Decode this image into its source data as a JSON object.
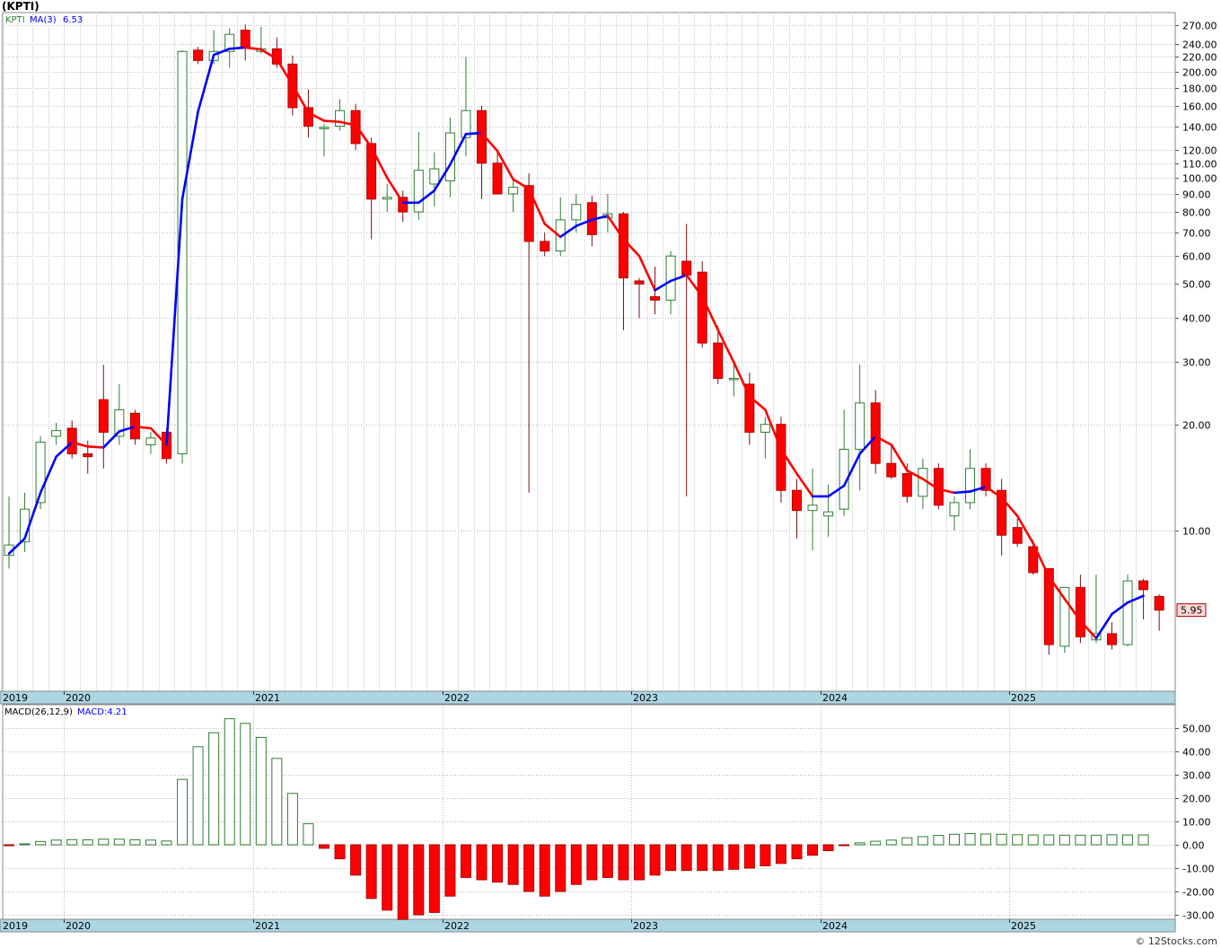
{
  "title": "(KPTI)",
  "legend": {
    "ticker": "KPTI",
    "ma_label": "MA(3)",
    "ma_value": "6.53"
  },
  "last_price_label": "5.95",
  "macd_legend": {
    "label": "MACD(26,12,9)",
    "value": "MACD:4.21"
  },
  "credit": "© 12Stocks.com",
  "colors": {
    "up_candle": "#2e7d32",
    "down_candle": "#ff0000",
    "ma_up": "#0000ff",
    "ma_down": "#ff0000",
    "macd_positive": "#2e7d32",
    "macd_negative": "#ff0000",
    "axis_band": "#acd6e2"
  },
  "chart_data": [
    {
      "type": "candlestick",
      "title": "(KPTI)",
      "scale": "log",
      "frequency": "monthly",
      "ylim": [
        4.6,
        290
      ],
      "y_ticks": [
        "270.00",
        "240.00",
        "220.00",
        "200.00",
        "180.00",
        "160.00",
        "140.00",
        "120.00",
        "110.00",
        "100.00",
        "90.00",
        "80.00",
        "70.00",
        "60.00",
        "50.00",
        "40.00",
        "30.00",
        "20.00",
        "10.00"
      ],
      "x_ticks": [
        "2019",
        "2020",
        "2021",
        "2022",
        "2023",
        "2024",
        "2025"
      ],
      "grid": true,
      "series": [
        {
          "name": "KPTI",
          "ohlc": [
            [
              8.5,
              12.5,
              7.8,
              9.1
            ],
            [
              9.3,
              12.8,
              8.7,
              11.5
            ],
            [
              12.0,
              18.5,
              11.5,
              17.8
            ],
            [
              18.5,
              20.2,
              17.5,
              19.2
            ],
            [
              19.5,
              20.5,
              16.0,
              16.5
            ],
            [
              16.5,
              18.0,
              14.5,
              16.2
            ],
            [
              23.5,
              29.5,
              15.0,
              19.0
            ],
            [
              18.5,
              26.0,
              17.5,
              22.0
            ],
            [
              21.5,
              22.0,
              17.5,
              18.2
            ],
            [
              17.5,
              19.0,
              16.5,
              18.3
            ],
            [
              19.0,
              19.5,
              15.5,
              16.0
            ],
            [
              16.5,
              230,
              15.5,
              228
            ],
            [
              230,
              235,
              210,
              215
            ],
            [
              215,
              262,
              210,
              228
            ],
            [
              228,
              265,
              205,
              255
            ],
            [
              262,
              272,
              215,
              235
            ],
            [
              228,
              268,
              225,
              232
            ],
            [
              232,
              250,
              205,
              210
            ],
            [
              210,
              222,
              150,
              158
            ],
            [
              158,
              178,
              130,
              140
            ],
            [
              138,
              142,
              115,
              139
            ],
            [
              140,
              167,
              136,
              155
            ],
            [
              155,
              162,
              120,
              125
            ],
            [
              125,
              130,
              67,
              87
            ],
            [
              87,
              96,
              80,
              88
            ],
            [
              88,
              92,
              75,
              80
            ],
            [
              80,
              135,
              76,
              105
            ],
            [
              96,
              118,
              83,
              106
            ],
            [
              98,
              148,
              88,
              134
            ],
            [
              130,
              220,
              115,
              155
            ],
            [
              155,
              160,
              87,
              110
            ],
            [
              110,
              120,
              90,
              90
            ],
            [
              90,
              100,
              80,
              94
            ],
            [
              95,
              103,
              12.8,
              66
            ],
            [
              66,
              70,
              60,
              62
            ],
            [
              62,
              88,
              60,
              76
            ],
            [
              76,
              90,
              70,
              84
            ],
            [
              85,
              89,
              64,
              69
            ],
            [
              77,
              90,
              70,
              79
            ],
            [
              79,
              80,
              37,
              52
            ],
            [
              51,
              52,
              40,
              50
            ],
            [
              46,
              56,
              41,
              45
            ],
            [
              45,
              62,
              41,
              60
            ],
            [
              58,
              74,
              12.5,
              53
            ],
            [
              54,
              58,
              33,
              34
            ],
            [
              34,
              38,
              26,
              27
            ],
            [
              27,
              30,
              24,
              27
            ],
            [
              26,
              28,
              17.5,
              19
            ],
            [
              19,
              21,
              16,
              20
            ],
            [
              20,
              21,
              12,
              13
            ],
            [
              13,
              14,
              9.5,
              11.4
            ],
            [
              11.4,
              15,
              8.8,
              11.8
            ],
            [
              11,
              13.5,
              9.6,
              11.3
            ],
            [
              11.5,
              22,
              11,
              17
            ],
            [
              17,
              29.5,
              13,
              23
            ],
            [
              23,
              25,
              14.5,
              15.5
            ],
            [
              15.5,
              17.5,
              14,
              14.2
            ],
            [
              14.5,
              15.5,
              12,
              12.5
            ],
            [
              12.5,
              16,
              11.5,
              15
            ],
            [
              15,
              15.5,
              11.5,
              11.8
            ],
            [
              11,
              12.5,
              10,
              12
            ],
            [
              12,
              17,
              11.5,
              15
            ],
            [
              15,
              15.5,
              12.5,
              13
            ],
            [
              13,
              14,
              8.5,
              9.7
            ],
            [
              10.2,
              10.8,
              9,
              9.2
            ],
            [
              9,
              9.4,
              7.5,
              7.6
            ],
            [
              7.8,
              7.8,
              4.45,
              4.75
            ],
            [
              4.7,
              6.9,
              4.5,
              6.9
            ],
            [
              6.9,
              7.5,
              4.8,
              5.0
            ],
            [
              4.9,
              7.5,
              4.8,
              5.1
            ],
            [
              5.1,
              5.5,
              4.6,
              4.75
            ],
            [
              4.75,
              7.5,
              4.7,
              7.2
            ],
            [
              7.2,
              7.3,
              5.6,
              6.8
            ],
            [
              6.5,
              6.6,
              5.2,
              5.95
            ]
          ]
        },
        {
          "name": "MA(3)",
          "values": [
            8.6,
            9.5,
            12.8,
            16.2,
            17.8,
            17.3,
            17.2,
            19.1,
            19.7,
            19.5,
            17.5,
            87,
            154,
            223,
            232,
            234,
            231,
            217,
            183,
            153,
            145,
            144,
            141,
            122,
            100,
            85,
            85,
            92,
            109,
            133,
            134,
            119,
            99,
            93,
            74,
            68,
            73,
            76,
            78,
            67,
            60,
            48,
            51,
            53,
            46,
            37,
            30,
            24,
            22,
            17,
            14.5,
            12.5,
            12.5,
            13.4,
            16.5,
            18.5,
            17.5,
            14.8,
            14.0,
            13.1,
            12.8,
            12.9,
            13.3,
            12.4,
            11,
            9.2,
            7.4,
            6.4,
            5.55,
            4.95,
            5.8,
            6.25,
            6.53
          ]
        }
      ]
    },
    {
      "type": "bar",
      "title": "MACD(26,12,9)",
      "ylim": [
        -32,
        55
      ],
      "y_ticks": [
        "50.00",
        "40.00",
        "30.00",
        "20.00",
        "10.00",
        "0.00",
        "-10.00",
        "-20.00",
        "-30.00"
      ],
      "x_ticks": [
        "2019",
        "2020",
        "2021",
        "2022",
        "2023",
        "2024",
        "2025"
      ],
      "grid": true,
      "series": [
        {
          "name": "MACD:4.21",
          "values": [
            -0.3,
            0.4,
            1.4,
            2.0,
            2.2,
            2.1,
            2.4,
            2.4,
            2.1,
            2.0,
            1.6,
            28,
            42,
            48,
            54,
            52,
            46,
            37,
            22,
            9,
            -1.5,
            -6,
            -13,
            -23,
            -28,
            -32,
            -30,
            -29,
            -22,
            -14,
            -15,
            -16,
            -17,
            -20,
            -22,
            -20,
            -17,
            -15,
            -14,
            -15,
            -15,
            -13,
            -11,
            -11,
            -11,
            -11,
            -10.5,
            -10,
            -9,
            -8,
            -6,
            -4.5,
            -2.5,
            -0.2,
            0.8,
            1.5,
            2,
            3,
            3.5,
            4,
            4.5,
            4.8,
            4.6,
            4.5,
            4.3,
            4.2,
            4.2,
            4.1,
            4.1,
            4.1,
            4.3,
            4.2,
            4.21
          ]
        }
      ]
    }
  ]
}
